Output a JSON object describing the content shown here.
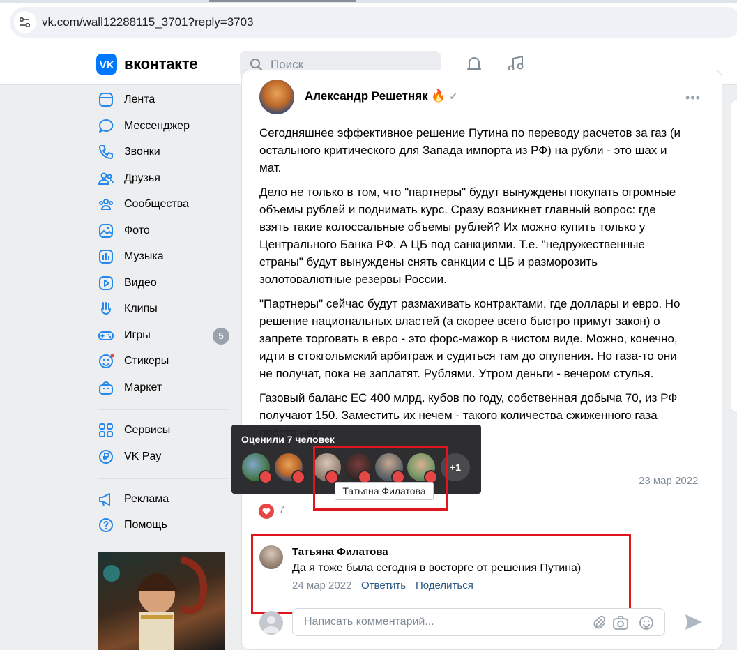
{
  "browser": {
    "url": "vk.com/wall12288115_3701?reply=3703"
  },
  "header": {
    "brand": "вконтакте",
    "search_placeholder": "Поиск"
  },
  "sidebar": {
    "items": [
      {
        "label": "Лента",
        "icon": "news-icon"
      },
      {
        "label": "Мессенджер",
        "icon": "chat-bubble-icon"
      },
      {
        "label": "Звонки",
        "icon": "phone-icon"
      },
      {
        "label": "Друзья",
        "icon": "friends-icon"
      },
      {
        "label": "Сообщества",
        "icon": "communities-icon"
      },
      {
        "label": "Фото",
        "icon": "photo-icon"
      },
      {
        "label": "Музыка",
        "icon": "music-icon"
      },
      {
        "label": "Видео",
        "icon": "video-icon"
      },
      {
        "label": "Клипы",
        "icon": "clips-icon"
      },
      {
        "label": "Игры",
        "icon": "gamepad-icon",
        "badge": "5"
      },
      {
        "label": "Стикеры",
        "icon": "sticker-icon"
      },
      {
        "label": "Маркет",
        "icon": "market-bag-icon"
      }
    ],
    "secondary": [
      {
        "label": "Сервисы",
        "icon": "services-grid-icon"
      },
      {
        "label": "VK Pay",
        "icon": "vkpay-icon"
      }
    ],
    "tertiary": [
      {
        "label": "Реклама",
        "icon": "megaphone-icon"
      },
      {
        "label": "Помощь",
        "icon": "help-icon"
      }
    ]
  },
  "post": {
    "author": "Александр Решетняк",
    "paragraphs": [
      [
        "Сегодняшнее эффективное решение Путина по переводу расчетов за газ (и",
        "остального критического для Запада импорта из РФ) на рубли - это шах и",
        "мат."
      ],
      [
        "Дело не только в том, что \"партнеры\" будут вынуждены покупать огромные",
        "объемы рублей и поднимать курс. Сразу возникнет главный вопрос: где",
        "взять такие колоссальные объемы рублей? Их можно купить только у",
        "Центрального Банка РФ. А ЦБ под санкциями. Т.е. \"недружественные",
        "страны\" будут вынуждены снять санкции с ЦБ и разморозить",
        "золотовалютные резервы России."
      ],
      [
        "\"Партнеры\" сейчас будут размахивать контрактами, где доллары и евро. Но",
        "решение национальных властей (а скорее всего быстро примут закон) о",
        "запрете торговать в евро - это форс-мажор в чистом виде. Можно, конечно,",
        "идти в стокгольмский арбитраж и судиться там до опупения. Но газа-то они",
        "не получат, пока не заплатят. Рублями. Утром деньги - вечером стулья."
      ],
      [
        "Газовый баланс ЕС 400 млрд. кубов по году, собственная добыча 70, из РФ",
        "получают 150. Заместить их нечем - такого количества сжиженного газа",
        "просто нет."
      ]
    ],
    "date": "23 мар 2022",
    "like_count": "7"
  },
  "likes_popup": {
    "title": "Оценили 7 человек",
    "more": "+1",
    "tooltip": "Татьяна Филатова"
  },
  "comment": {
    "author": "Татьяна Филатова",
    "text": "Да я тоже была сегодня в восторге от решения Путина)",
    "date": "24 мар 2022",
    "reply": "Ответить",
    "share": "Поделиться"
  },
  "composer": {
    "placeholder": "Написать комментарий..."
  },
  "colors": {
    "accent": "#0077ff",
    "link": "#2a5885",
    "like": "#e64646",
    "highlight": "#e0161c"
  }
}
